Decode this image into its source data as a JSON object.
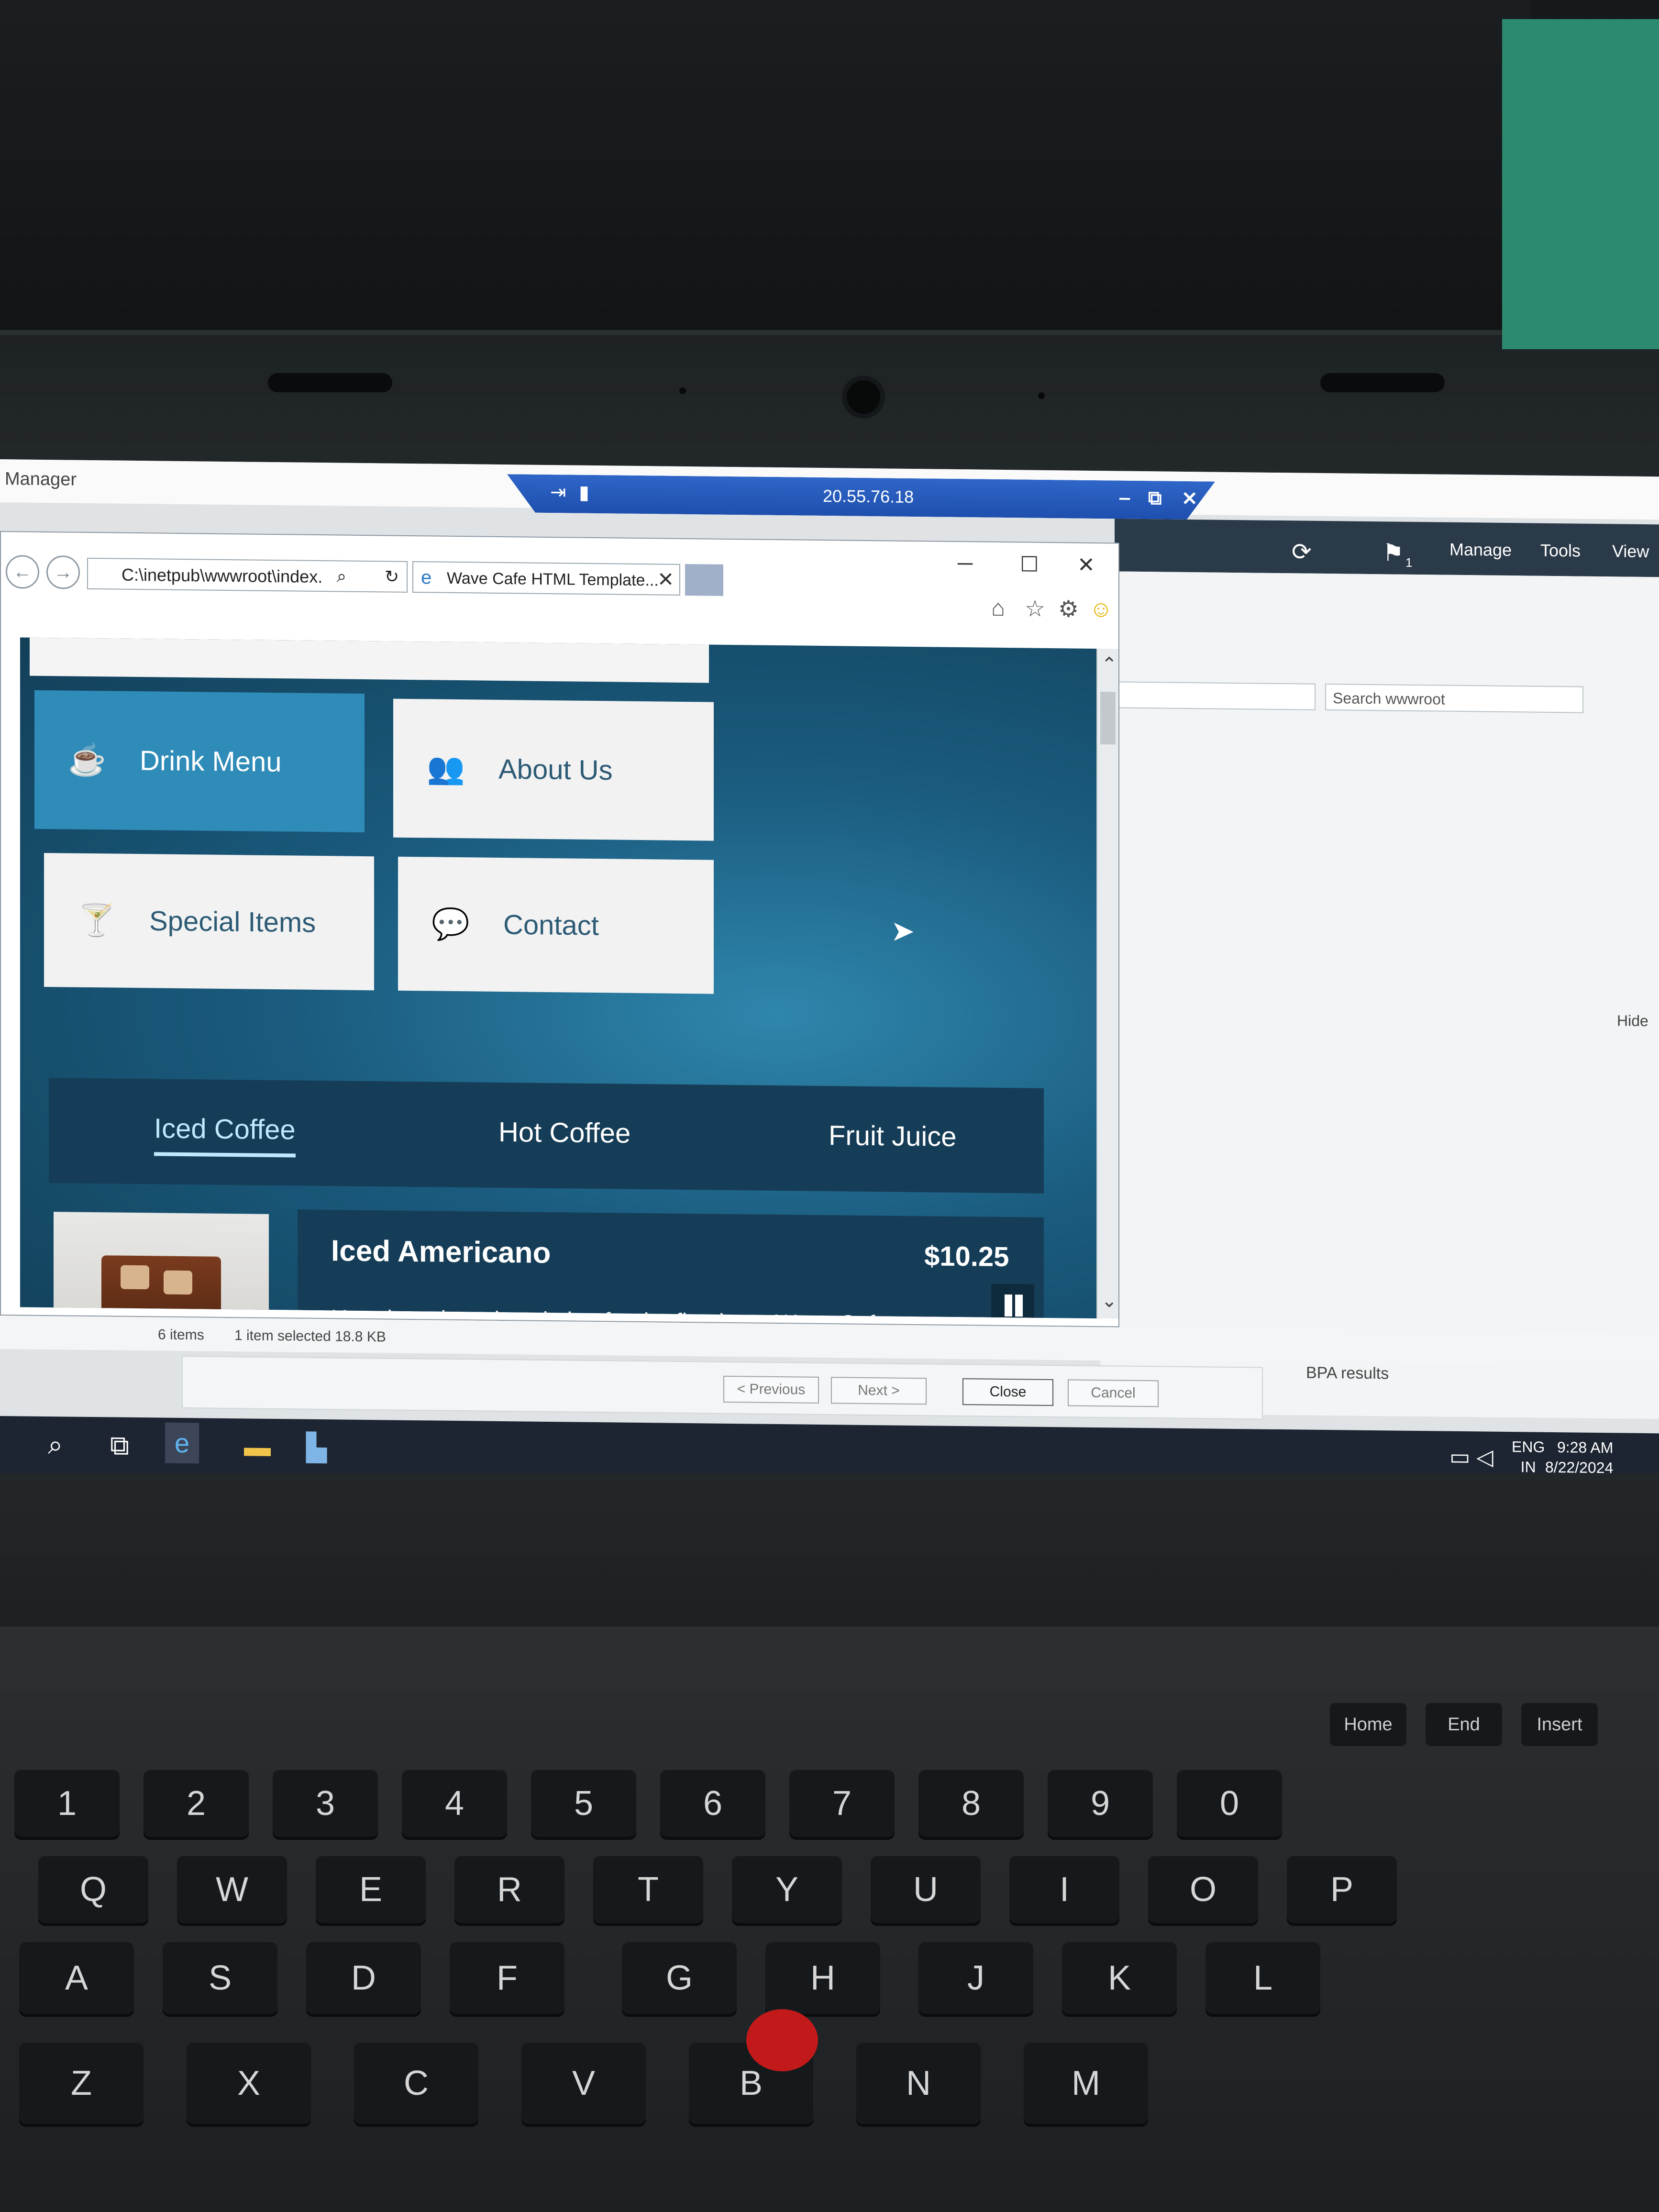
{
  "server_manager": {
    "title": "Manager",
    "toolbar": {
      "manage": "Manage",
      "tools": "Tools",
      "view": "View",
      "flag_count": "1"
    },
    "search_placeholder": "Search wwwroot",
    "hide_label": "Hide"
  },
  "rdp": {
    "ip": "20.55.76.18",
    "min": "‒",
    "restore": "⧉",
    "close": "✕"
  },
  "browser": {
    "address": "C:\\inetpub\\wwwroot\\index.",
    "tab_title": "Wave Cafe HTML Template...",
    "tab_close": "✕",
    "win_min": "─",
    "win_max": "☐",
    "win_close": "✕"
  },
  "page": {
    "menu": [
      {
        "label": "Drink Menu",
        "icon": "coffee-cup-icon"
      },
      {
        "label": "About Us",
        "icon": "users-icon"
      },
      {
        "label": "Special Items",
        "icon": "cocktail-icon"
      },
      {
        "label": "Contact",
        "icon": "chat-icon"
      }
    ],
    "tabs": [
      "Iced Coffee",
      "Hot Coffee",
      "Fruit Juice"
    ],
    "item": {
      "name": "Iced Americano",
      "price": "$10.25",
      "description": "Here is a short description for the first item. Wave Cafe Template is provided by Tooplate."
    }
  },
  "status": {
    "count": "6 items",
    "selected": "1 item selected  18.8 KB"
  },
  "dialog": {
    "previous": "< Previous",
    "next": "Next >",
    "close": "Close",
    "cancel": "Cancel"
  },
  "bpa_results": "BPA results",
  "tray": {
    "lang1": "ENG",
    "lang2": "IN",
    "time": "9:28 AM",
    "date": "8/22/2024"
  },
  "keyboard": {
    "row_num": [
      "1",
      "2",
      "3",
      "4",
      "5",
      "6",
      "7",
      "8",
      "9",
      "0"
    ],
    "row_q": [
      "Q",
      "W",
      "E",
      "R",
      "T",
      "Y",
      "U",
      "I",
      "O",
      "P"
    ],
    "row_a": [
      "A",
      "S",
      "D",
      "F",
      "G",
      "H",
      "J",
      "K",
      "L"
    ],
    "row_z": [
      "Z",
      "X",
      "C",
      "V",
      "B",
      "N",
      "M"
    ],
    "nav": [
      "Home",
      "End",
      "Insert"
    ]
  },
  "colors": {
    "accent": "#2f8bb8",
    "card": "#163d57",
    "taskbar": "#1e2532",
    "rdp": "#2f66c8"
  }
}
